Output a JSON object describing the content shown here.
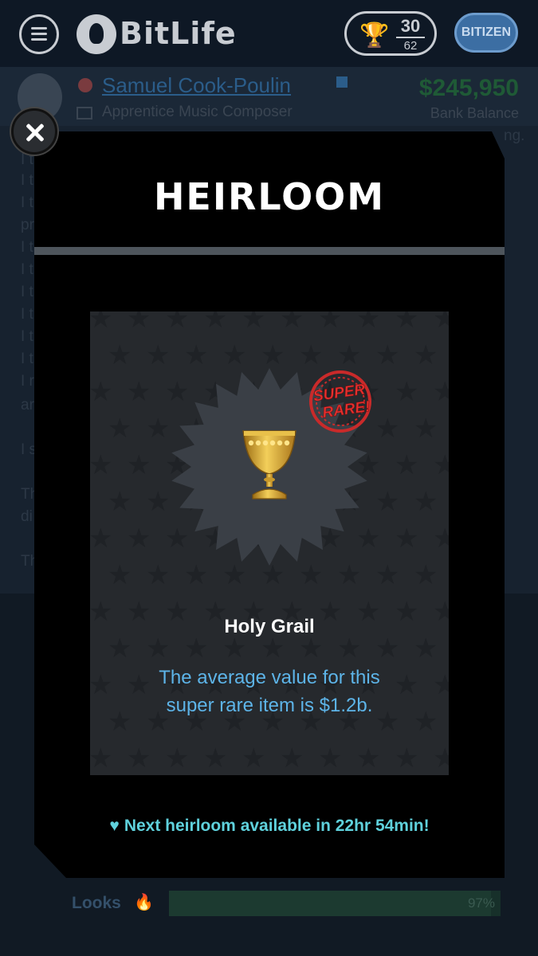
{
  "header": {
    "app_name": "BitLife",
    "trophy_count": "30",
    "trophy_total": "62",
    "bitizen_label": "BITIZEN"
  },
  "profile": {
    "name": "Samuel Cook-Poulin",
    "job": "Apprentice Music Composer",
    "balance": "$245,950",
    "balance_label": "Bank Balance"
  },
  "stats": {
    "looks_label": "Looks",
    "looks_pct": "97%",
    "looks_value": 0.97
  },
  "modal": {
    "title": "HEIRLOOM",
    "badge": "SUPER RARE!",
    "item_name": "Holy Grail",
    "description": "The average value for this super rare item is $1.2b.",
    "footer": "Next heirloom available in 22hr 54min!"
  },
  "colors": {
    "accent_blue": "#5db4e8",
    "accent_teal": "#5fd1dc",
    "badge_red": "#d62f2f",
    "gold": "#d6a629"
  }
}
